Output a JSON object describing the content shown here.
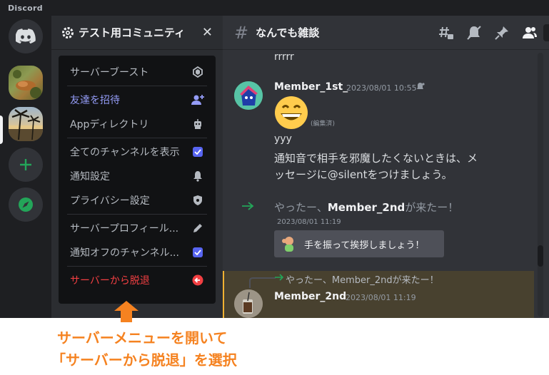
{
  "window": {
    "app_name": "Discord"
  },
  "server": {
    "name": "テスト用コミュニティ"
  },
  "channel": {
    "name": "なんでも雑談"
  },
  "server_menu": {
    "items": [
      {
        "label": "サーバーブースト",
        "icon": "boost-gem-icon"
      },
      {
        "label": "友達を招待",
        "icon": "add-person-icon"
      },
      {
        "label": "Appディレクトリ",
        "icon": "robot-icon"
      },
      {
        "label": "全てのチャンネルを表示",
        "icon": "checkbox-checked"
      },
      {
        "label": "通知設定",
        "icon": "bell-icon"
      },
      {
        "label": "プライバシー設定",
        "icon": "shield-icon"
      },
      {
        "label": "サーバープロフィール...",
        "icon": "pencil-icon"
      },
      {
        "label": "通知オフのチャンネル...",
        "icon": "checkbox-checked"
      },
      {
        "label": "サーバーから脱退",
        "icon": "leave-icon"
      }
    ]
  },
  "messages": {
    "prev_text": "rrrrr",
    "m1": {
      "author": "Member_1st_",
      "timestamp": "2023/08/01 10:55",
      "edited": "(編集済)",
      "line1": "yyy",
      "line2": "通知音で相手を邪魔したくないときは、メ",
      "line3": "ッセージに@silentをつけましょう。"
    },
    "join": {
      "prefix": "やったー、",
      "name": "Member_2nd",
      "suffix": "が来たー！",
      "timestamp": "2023/08/01 11:19",
      "wave_label": "手を振って挨拶しましょう！"
    },
    "reply": {
      "reference": "やったー、Member_2ndが来たー！",
      "author": "Member_2nd",
      "timestamp": "2023/08/01 11:19"
    }
  },
  "caption": {
    "line1": "サーバーメニューを開いて",
    "line2": "「サーバーから脱退」を選択"
  },
  "colors": {
    "accent_orange": "#f58220",
    "danger": "#f23f42",
    "blurple": "#5865f2",
    "online_green": "#23a559"
  }
}
